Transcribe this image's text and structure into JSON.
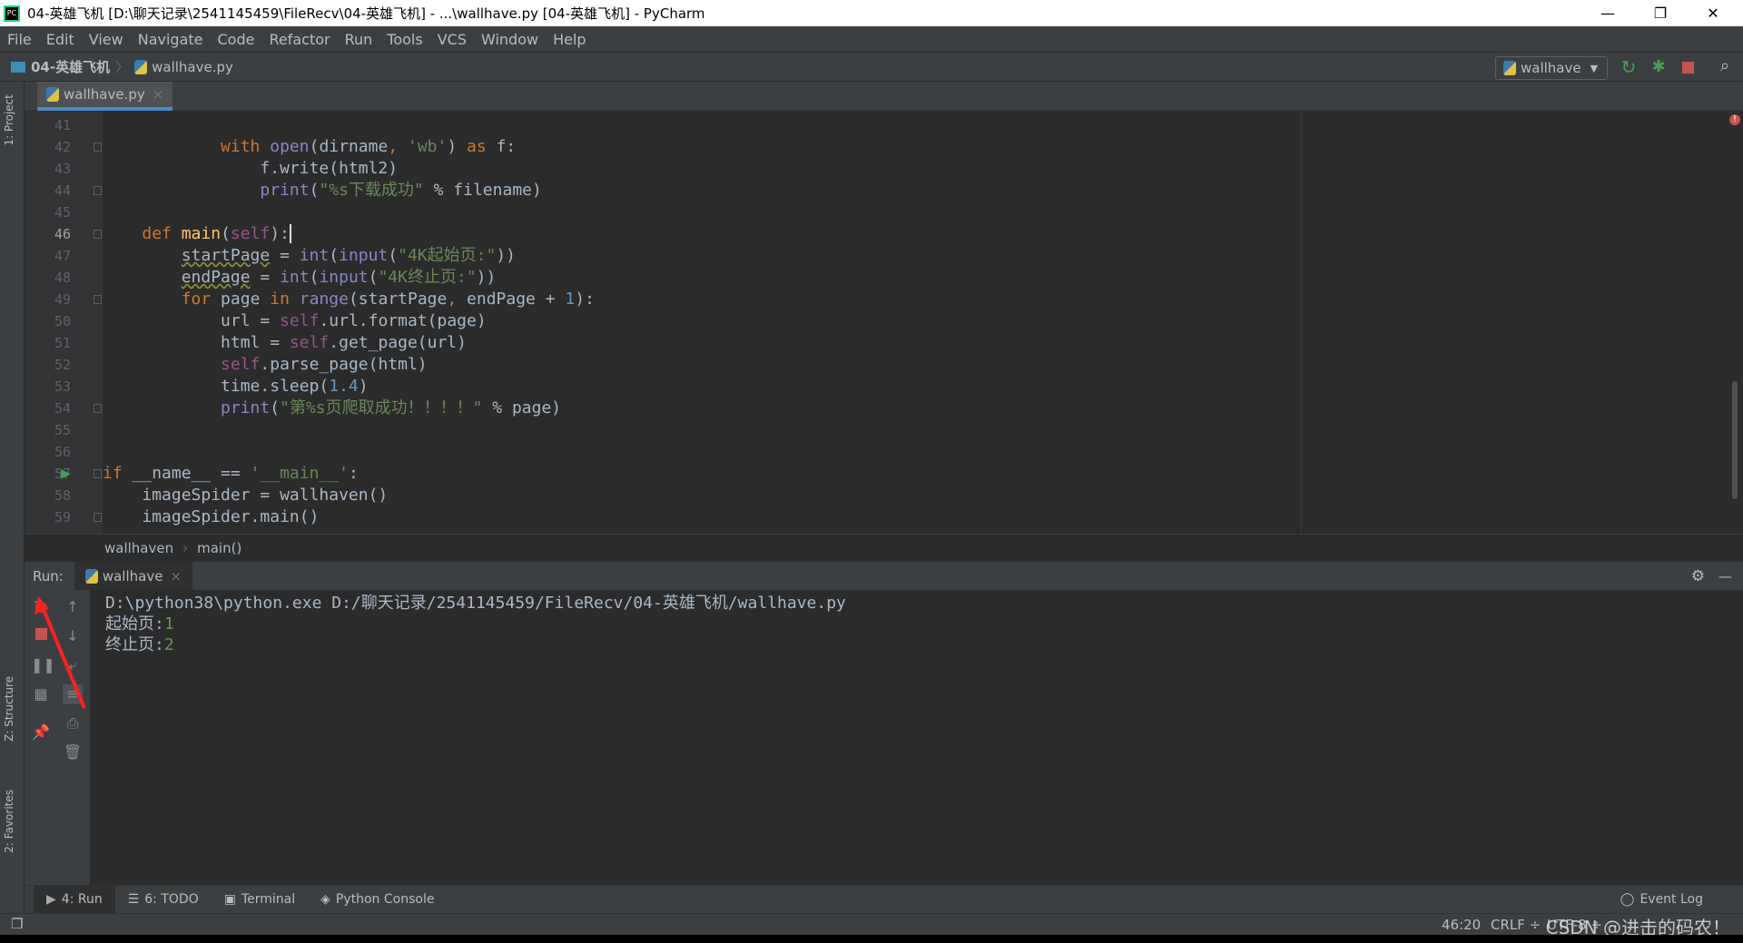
{
  "window": {
    "title": "04-英雄飞机 [D:\\聊天记录\\2541145459\\FileRecv\\04-英雄飞机] - ...\\wallhave.py [04-英雄飞机] - PyCharm",
    "app_icon": "PC"
  },
  "menu": [
    "File",
    "Edit",
    "View",
    "Navigate",
    "Code",
    "Refactor",
    "Run",
    "Tools",
    "VCS",
    "Window",
    "Help"
  ],
  "navbar": {
    "project": "04-英雄飞机",
    "file": "wallhave.py",
    "run_config": "wallhave"
  },
  "editor_tab": {
    "label": "wallhave.py"
  },
  "side_tabs": {
    "project": "1: Project",
    "structure": "Z: Structure",
    "favorites": "2: Favorites"
  },
  "code": {
    "current_line": 46,
    "lines": [
      {
        "n": "41",
        "t": []
      },
      {
        "n": "42",
        "t": [
          [
            "            ",
            ""
          ],
          [
            "with",
            "kw"
          ],
          [
            " ",
            ""
          ],
          [
            "open",
            "bi"
          ],
          [
            "(dirname",
            ""
          ],
          [
            ",",
            "kw"
          ],
          [
            " ",
            ""
          ],
          [
            "'wb'",
            "st"
          ],
          [
            ") ",
            ""
          ],
          [
            "as",
            "kw"
          ],
          [
            " f:",
            ""
          ]
        ]
      },
      {
        "n": "43",
        "t": [
          [
            "                f.write(html2)",
            ""
          ]
        ]
      },
      {
        "n": "44",
        "t": [
          [
            "                ",
            ""
          ],
          [
            "print",
            "bi"
          ],
          [
            "(",
            ""
          ],
          [
            "\"%s下载成功\"",
            "st"
          ],
          [
            " % filename)",
            ""
          ]
        ]
      },
      {
        "n": "45",
        "t": []
      },
      {
        "n": "46",
        "t": [
          [
            "    ",
            ""
          ],
          [
            "def",
            "kw"
          ],
          [
            " ",
            ""
          ],
          [
            "main",
            "fn"
          ],
          [
            "(",
            ""
          ],
          [
            "self",
            "sf"
          ],
          [
            "):",
            ""
          ]
        ]
      },
      {
        "n": "47",
        "t": [
          [
            "        ",
            ""
          ],
          [
            "startPage",
            "wv"
          ],
          [
            " = ",
            ""
          ],
          [
            "int",
            "bi"
          ],
          [
            "(",
            ""
          ],
          [
            "input",
            "bi"
          ],
          [
            "(",
            ""
          ],
          [
            "\"4K起始页:\"",
            "st"
          ],
          [
            "))",
            ""
          ]
        ]
      },
      {
        "n": "48",
        "t": [
          [
            "        ",
            ""
          ],
          [
            "endPage",
            "wv"
          ],
          [
            " = ",
            ""
          ],
          [
            "int",
            "bi"
          ],
          [
            "(",
            ""
          ],
          [
            "input",
            "bi"
          ],
          [
            "(",
            ""
          ],
          [
            "\"4K终止页:\"",
            "st"
          ],
          [
            "))",
            ""
          ]
        ]
      },
      {
        "n": "49",
        "t": [
          [
            "        ",
            ""
          ],
          [
            "for",
            "kw"
          ],
          [
            " page ",
            ""
          ],
          [
            "in",
            "kw"
          ],
          [
            " ",
            ""
          ],
          [
            "range",
            "bi"
          ],
          [
            "(startPage",
            ""
          ],
          [
            ",",
            "kw"
          ],
          [
            " endPage + ",
            ""
          ],
          [
            "1",
            "nu"
          ],
          [
            "):",
            ""
          ]
        ]
      },
      {
        "n": "50",
        "t": [
          [
            "            url = ",
            ""
          ],
          [
            "self",
            "sf"
          ],
          [
            ".url.format(page)",
            ""
          ]
        ]
      },
      {
        "n": "51",
        "t": [
          [
            "            html = ",
            ""
          ],
          [
            "self",
            "sf"
          ],
          [
            ".get_page(url)",
            ""
          ]
        ]
      },
      {
        "n": "52",
        "t": [
          [
            "            ",
            ""
          ],
          [
            "self",
            "sf"
          ],
          [
            ".parse_page(html)",
            ""
          ]
        ]
      },
      {
        "n": "53",
        "t": [
          [
            "            time.sleep(",
            ""
          ],
          [
            "1.4",
            "nu"
          ],
          [
            ")",
            ""
          ]
        ]
      },
      {
        "n": "54",
        "t": [
          [
            "            ",
            ""
          ],
          [
            "print",
            "bi"
          ],
          [
            "(",
            ""
          ],
          [
            "\"第%s页爬取成功！！！！\"",
            "st"
          ],
          [
            " % page)",
            ""
          ]
        ]
      },
      {
        "n": "55",
        "t": []
      },
      {
        "n": "56",
        "t": []
      },
      {
        "n": "57",
        "t": [
          [
            "if",
            "kw"
          ],
          [
            " __name__ == ",
            ""
          ],
          [
            "'__main__'",
            "st"
          ],
          [
            ":",
            ""
          ]
        ]
      },
      {
        "n": "58",
        "t": [
          [
            "    imageSpider = wallhaven()",
            ""
          ]
        ]
      },
      {
        "n": "59",
        "t": [
          [
            "    imageSpider.main()",
            ""
          ]
        ]
      }
    ]
  },
  "breadcrumb": [
    "wallhaven",
    "main()"
  ],
  "run": {
    "label": "Run:",
    "tab": "wallhave",
    "console": [
      {
        "text": "D:\\python38\\python.exe D:/聊天记录/2541145459/FileRecv/04-英雄飞机/wallhave.py",
        "input": ""
      },
      {
        "text": "起始页:",
        "input": "1"
      },
      {
        "text": "终止页:",
        "input": "2"
      }
    ]
  },
  "bottom_tabs": [
    "4: Run",
    "6: TODO",
    "Terminal",
    "Python Console"
  ],
  "event_log": "Event Log",
  "status": {
    "position": "46:20",
    "line_sep": "CRLF ÷",
    "encoding": "UTF-8 ÷"
  },
  "watermark": "CSDN @进击的码农！",
  "colors": {
    "keyword": "#cc7832",
    "builtin": "#8888c6",
    "string": "#6a8759",
    "number": "#6897bb",
    "self": "#94558d",
    "accent": "#4a88c7",
    "run_green": "#499c54",
    "stop_red": "#c75450"
  }
}
